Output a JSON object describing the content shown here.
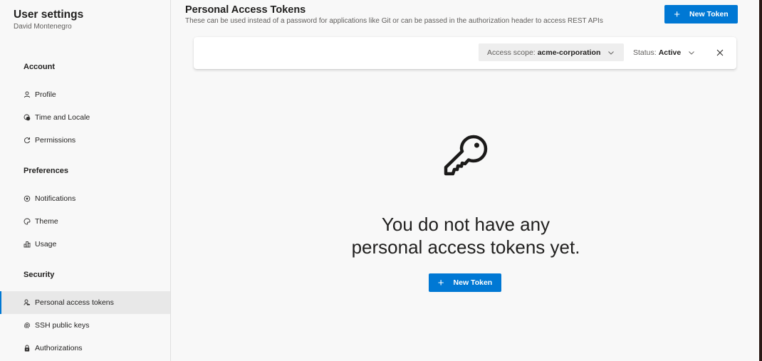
{
  "sidebar": {
    "title": "User settings",
    "user_name": "David Montenegro",
    "groups": [
      {
        "label": "Account",
        "items": [
          {
            "label": "Profile",
            "icon": "profile-icon"
          },
          {
            "label": "Time and Locale",
            "icon": "globe-clock-icon"
          },
          {
            "label": "Permissions",
            "icon": "refresh-icon"
          }
        ]
      },
      {
        "label": "Preferences",
        "items": [
          {
            "label": "Notifications",
            "icon": "notification-icon"
          },
          {
            "label": "Theme",
            "icon": "palette-icon"
          },
          {
            "label": "Usage",
            "icon": "chart-icon"
          }
        ]
      },
      {
        "label": "Security",
        "items": [
          {
            "label": "Personal access tokens",
            "icon": "person-key-icon",
            "selected": true
          },
          {
            "label": "SSH public keys",
            "icon": "fingerprint-icon"
          },
          {
            "label": "Authorizations",
            "icon": "lock-icon"
          }
        ]
      }
    ]
  },
  "main": {
    "title": "Personal Access Tokens",
    "description": "These can be used instead of a password for applications like Git or can be passed in the authorization header to access REST APIs",
    "new_token_label": "New Token",
    "filters": {
      "scope_label": "Access scope:",
      "scope_value": "acme-corporation",
      "status_label": "Status:",
      "status_value": "Active"
    },
    "empty_state": {
      "icon": "key-icon",
      "message_line1": "You do not have any",
      "message_line2": "personal access tokens yet.",
      "button_label": "New Token"
    }
  },
  "colors": {
    "accent": "#0078d4",
    "background": "#f8f8f8",
    "selected_item": "#e8e8e8"
  }
}
